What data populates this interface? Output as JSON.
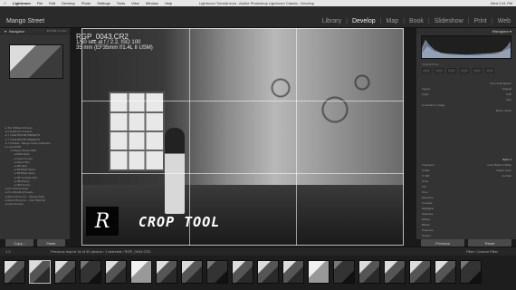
{
  "menubar": {
    "apple": "",
    "items": [
      "Lightroom",
      "File",
      "Edit",
      "Develop",
      "Photo",
      "Settings",
      "Tools",
      "View",
      "Window",
      "Help"
    ],
    "window_title": "Lightroom Tutorial.lrcat - Adobe Photoshop Lightroom Classic - Develop",
    "right": "Wed 2:41 PM"
  },
  "header": {
    "identity_plate": "Mango Street",
    "modules": [
      "Library",
      "Develop",
      "Map",
      "Book",
      "Slideshow",
      "Print",
      "Web"
    ],
    "active_module": "Develop"
  },
  "left_panel": {
    "navigator_label": "Navigator",
    "navigator_fit": "FIT  FILL  1:1  3:1",
    "presets": [
      "Tim Wallace Presets",
      "0 Lightroom Presets",
      "Y LIGHTROOM PRESETS",
      "Y LIGHTROOM PRESETS",
      "Y Presets - Mango Street Collection",
      "Local PSM",
      "Mango Street 2019",
      "B&W Dark",
      "Autumn Love",
      "Warm Film",
      "HB Haze",
      "SB Black Warm",
      "SB Black Spicy",
      "SB Contrast Soft",
      "HB Moody",
      "HB Punchy",
      "Pro Portrait Suite",
      "Pro Wedding Presets",
      "Retro Photo Co. - Moody Pack",
      "Retro Photo Co. - Film Pack 98",
      "User Presets"
    ],
    "sections": [
      "Snapshots",
      "History",
      "Collections"
    ],
    "copy_label": "Copy...",
    "paste_label": "Paste"
  },
  "photo_info": {
    "filename": "RGP_0043.CR2",
    "exposure": "1/50 sec at f / 2.2, ISO 100",
    "lens": "35 mm (EF35mm f/1.4L II USM)"
  },
  "overlay": {
    "logo_letter": "R",
    "title": "CROP TOOL"
  },
  "right_panel": {
    "histogram_label": "Histogram",
    "original_photo": "Original Photo",
    "crop_label": "Crop & Straighten",
    "aspect_label": "Aspect",
    "aspect_value": "Original",
    "angle_label": "Angle",
    "angle_value": "0.00",
    "auto_label": "Auto",
    "constrain_label": "Constrain to Image",
    "reset_label": "Reset",
    "close_label": "Close",
    "basic_label": "Basic",
    "treatment_label": "Treatment",
    "treatment_color": "Color",
    "treatment_bw": "Black & White",
    "profile_label": "Profile",
    "profile_value": "Adobe Color",
    "wb_label": "WB",
    "wb_value": "As Shot",
    "basic_rows": [
      "Temp",
      "Tint",
      "Tone",
      "Exposure",
      "Contrast",
      "Highlights",
      "Shadows",
      "Whites",
      "Blacks",
      "Presence",
      "Texture",
      "Clarity",
      "Dehaze",
      "Vibrance",
      "Saturation"
    ],
    "previous_label": "Previous",
    "reset_btn": "Reset"
  },
  "filmstrip": {
    "left_info": "1 2",
    "path": "Previous Import  16 of 50 photos / 1 selected / RGP_0043.CR2",
    "filter_label": "Filter",
    "filter_value": "Custom Filter",
    "thumb_count": 19,
    "selected_index": 1
  }
}
